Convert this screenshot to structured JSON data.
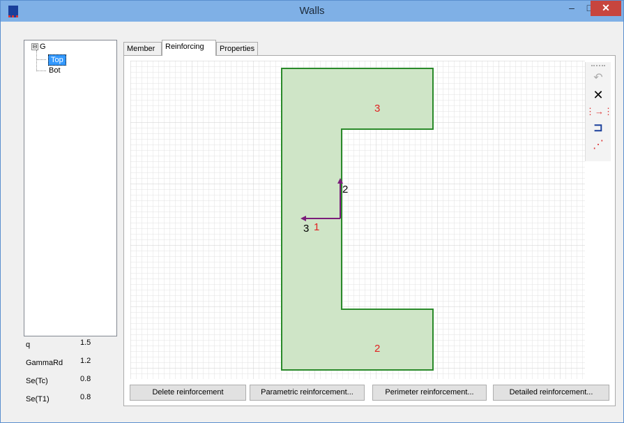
{
  "window": {
    "title": "Walls",
    "minimize": "–",
    "maximize": "□",
    "close": "✕"
  },
  "tree": {
    "root": "G",
    "expander": "⊟",
    "children": [
      "Top",
      "Bot"
    ],
    "selected": "Top"
  },
  "properties": [
    {
      "name": "q",
      "value": "1.5"
    },
    {
      "name": "GammaRd",
      "value": "1.2"
    },
    {
      "name": "Se(Tc)",
      "value": "0.8"
    },
    {
      "name": "Se(T1)",
      "value": "0.8"
    }
  ],
  "tabs": [
    "Member",
    "Reinforcing",
    "Properties"
  ],
  "active_tab": "Reinforcing",
  "drawing": {
    "edge_labels": [
      "3",
      "2",
      "1"
    ],
    "axis_labels": [
      "2",
      "3"
    ],
    "fill_color": "#cfe5c7",
    "edge_color": "#2a8a2a",
    "label_color": "#e02020",
    "axis_color": "#7a1d7a"
  },
  "toolbar": {
    "undo": "↶",
    "delete": "✕",
    "snap": "⋮→⋮",
    "shape": "⊐",
    "line": "⋰"
  },
  "buttons": [
    "Delete reinforcement",
    "Parametric reinforcement...",
    "Perimeter reinforcement...",
    "Detailed reinforcement..."
  ]
}
